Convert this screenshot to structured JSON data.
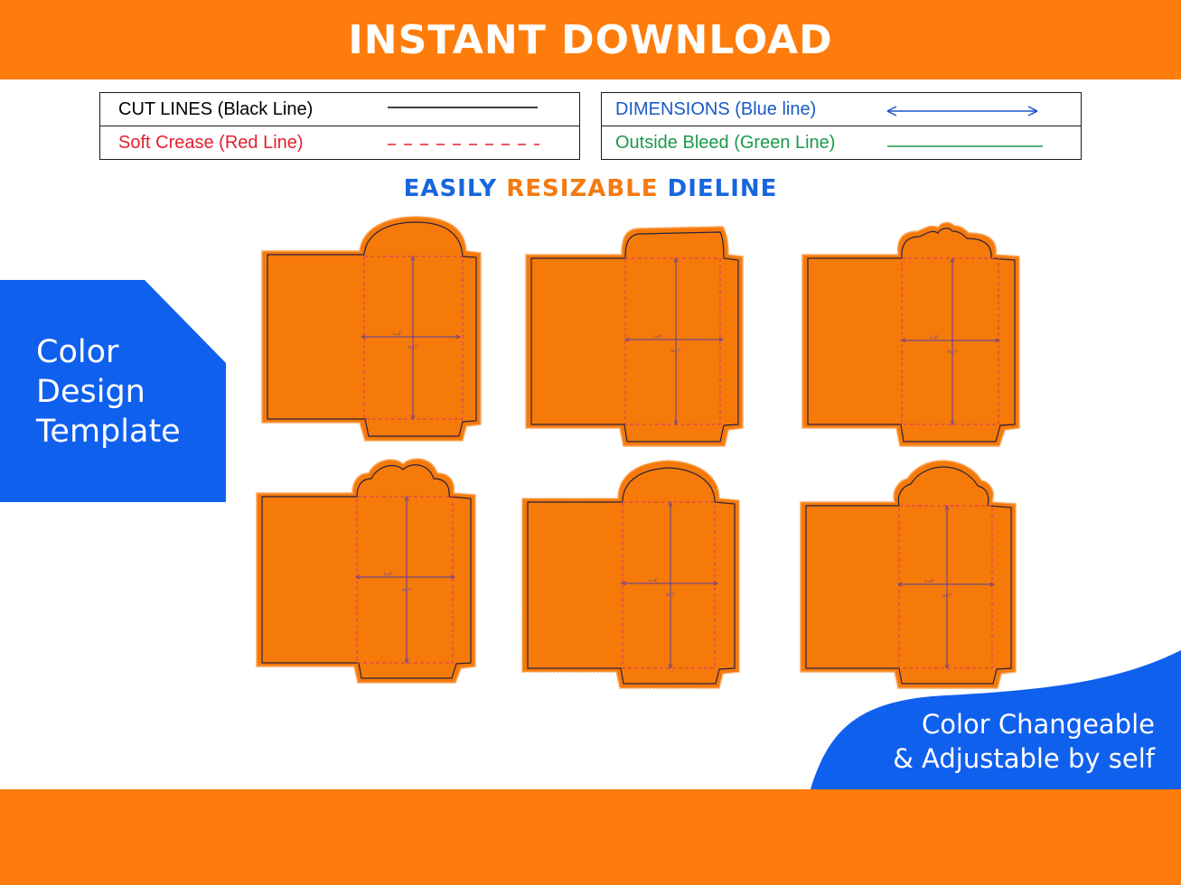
{
  "header": {
    "title": "INSTANT DOWNLOAD"
  },
  "legend": {
    "left": [
      {
        "label": "CUT LINES (Black Line)",
        "color": "#000000",
        "style": "solid"
      },
      {
        "label": "Soft Crease (Red Line)",
        "color": "#e0202e",
        "style": "dashed"
      }
    ],
    "right": [
      {
        "label": "DIMENSIONS (Blue line)",
        "color": "#1a58c8",
        "style": "arrow"
      },
      {
        "label": "Outside Bleed (Green Line)",
        "color": "#1a9a4a",
        "style": "solid"
      }
    ]
  },
  "headline": {
    "part1": "EASILY ",
    "part2": "RESIZABLE",
    "part3": " DIELINE"
  },
  "left_badge": {
    "lines": [
      "Color",
      "Design",
      "Template"
    ]
  },
  "right_badge": {
    "lines": [
      "Color Changeable",
      "& Adjustable by self"
    ]
  },
  "colors": {
    "orange": "#fe7c0c",
    "blue": "#1060ee",
    "dieline_fill": "#f57a0a",
    "dieline_outline": "#1f1f3a",
    "crease": "#d8356a",
    "dimension": "#5a3aa0"
  },
  "dielines": [
    {
      "flap": "arch",
      "width_label": "L=4\"",
      "height_label": "H=7\""
    },
    {
      "flap": "flat",
      "width_label": "L=4\"",
      "height_label": "H=7\""
    },
    {
      "flap": "bow",
      "width_label": "L=4\"",
      "height_label": "H=7\""
    },
    {
      "flap": "cloud",
      "width_label": "L=4\"",
      "height_label": "H=7\""
    },
    {
      "flap": "scallop",
      "width_label": "L=4\"",
      "height_label": "H=7\""
    },
    {
      "flap": "bell",
      "width_label": "L=4\"",
      "height_label": "H=7\""
    }
  ]
}
